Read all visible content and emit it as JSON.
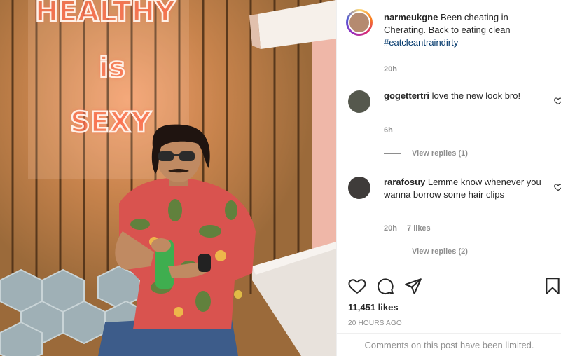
{
  "photo": {
    "neon_lines": [
      "HEALTHY",
      "is",
      "SEXY"
    ]
  },
  "post": {
    "author": "narmeukgne",
    "caption_text": "Been cheating in Cherating. Back to eating clean",
    "hashtag": "#eatcleantraindirty",
    "time": "20h"
  },
  "comments": [
    {
      "user": "gogettertri",
      "text": "love the new look bro!",
      "time": "6h",
      "likes": "",
      "view_replies": "View replies (1)"
    },
    {
      "user": "rarafosuy",
      "text": "Lemme know whenever you wanna borrow some hair clips",
      "time": "20h",
      "likes": "7 likes",
      "view_replies": "View replies (2)"
    }
  ],
  "actions": {
    "icons": [
      "heart-icon",
      "comment-icon",
      "share-icon",
      "bookmark-icon"
    ],
    "likes_count": "11,451 likes",
    "time_ago": "20 HOURS AGO",
    "comments_limited": "Comments on this post have been limited."
  },
  "colors": {
    "hashtag": "#00376b",
    "muted": "#8e8e8e",
    "text": "#262626",
    "neon": "#ff6a4d"
  }
}
